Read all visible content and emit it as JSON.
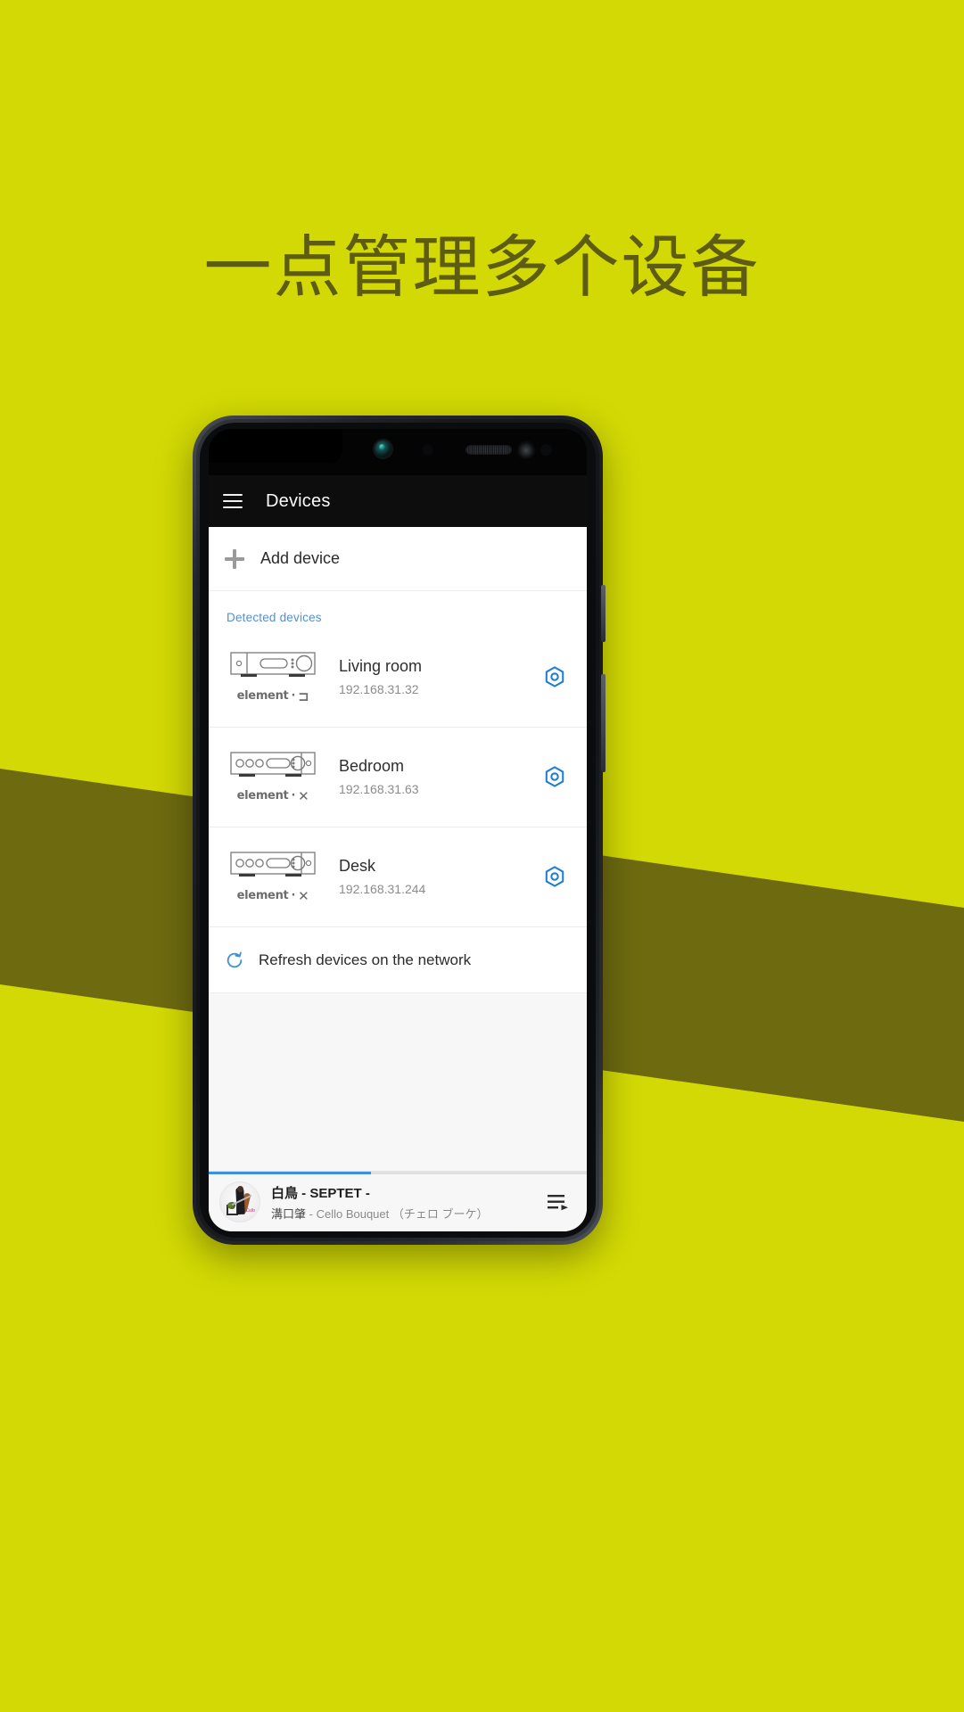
{
  "promo": {
    "headline": "一点管理多个设备",
    "background_color": "#d2d904",
    "band_color": "#6d6a10"
  },
  "app": {
    "appbar": {
      "menu_icon": "hamburger-menu-icon",
      "title": "Devices"
    },
    "add_device": {
      "icon": "plus-icon",
      "label": "Add device"
    },
    "section": {
      "label": "Detected devices",
      "label_color": "#4f90d8"
    },
    "devices": [
      {
        "brand": "element",
        "brand_separator": "·",
        "brand_mark": "⊐",
        "name": "Living room",
        "ip": "192.168.31.32",
        "settings_icon": "gear-hex-icon",
        "variant": "single-knob"
      },
      {
        "brand": "element",
        "brand_separator": "·",
        "brand_mark": "✕",
        "name": "Bedroom",
        "ip": "192.168.31.63",
        "settings_icon": "gear-hex-icon",
        "variant": "triple-knob"
      },
      {
        "brand": "element",
        "brand_separator": "·",
        "brand_mark": "✕",
        "name": "Desk",
        "ip": "192.168.31.244",
        "settings_icon": "gear-hex-icon",
        "variant": "triple-knob"
      }
    ],
    "refresh": {
      "icon": "refresh-icon",
      "label": "Refresh devices on the network",
      "icon_color": "#3f8fe0"
    },
    "now_playing": {
      "title": "白鳥 - SEPTET -",
      "artist": "溝口肇",
      "album": "- Cello Bouquet （チェロ ブーケ）",
      "progress_percent": 43,
      "progress_color": "#3f8fe0",
      "queue_icon": "playlist-play-icon",
      "artwork_icon": "album-artwork"
    }
  }
}
